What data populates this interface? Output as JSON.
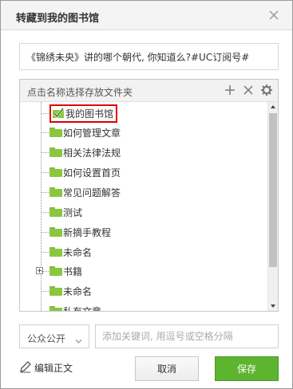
{
  "dialog": {
    "title": "转藏到我的图书馆"
  },
  "article": {
    "title": "《锦绣未央》讲的哪个朝代, 你知道么?#UC订阅号#"
  },
  "folder_panel": {
    "header": "点击名称选择存放文件夹",
    "icons": {
      "add": "plus-icon",
      "remove": "close-icon",
      "settings": "gear-icon"
    },
    "folders": [
      {
        "label": "我的图书馆",
        "selected": true
      },
      {
        "label": "如何管理文章"
      },
      {
        "label": "相关法律法规"
      },
      {
        "label": "如何设置首页"
      },
      {
        "label": "常见问题解答"
      },
      {
        "label": "测试"
      },
      {
        "label": "新摘手教程"
      },
      {
        "label": "未命名"
      },
      {
        "label": "书籍",
        "expandable": true
      },
      {
        "label": "未命名"
      },
      {
        "label": "私有文章"
      }
    ]
  },
  "privacy": {
    "selected": "公众公开"
  },
  "keywords": {
    "placeholder": "添加关键词, 用逗号或空格分隔"
  },
  "footer": {
    "edit_label": "编辑正文",
    "cancel_label": "取消",
    "save_label": "保存"
  },
  "colors": {
    "folder": "#8cc63f",
    "save_button": "#5db42f",
    "selection_border": "#e00000"
  }
}
